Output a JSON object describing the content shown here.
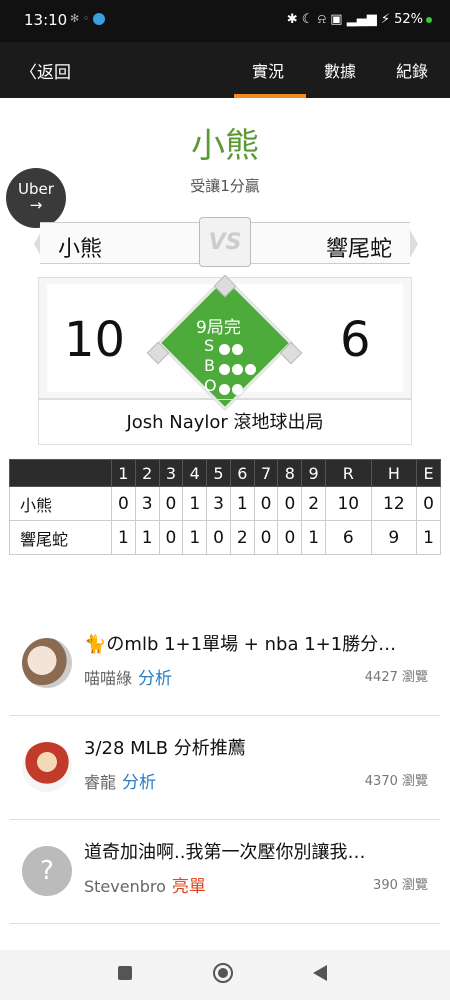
{
  "status_bar": {
    "time": "13:10",
    "battery": "52%"
  },
  "nav": {
    "back_label": "返回",
    "tabs": [
      {
        "label": "實況",
        "active": true
      },
      {
        "label": "數據",
        "active": false
      },
      {
        "label": "紀錄",
        "active": false
      }
    ]
  },
  "game": {
    "winner": "小熊",
    "result_text": "受讓1分贏",
    "team_home": "小熊",
    "team_away": "響尾蛇",
    "vs_label": "VS",
    "score_home": "10",
    "score_away": "6",
    "inning_status": "9局完",
    "count_labels": {
      "s": "S",
      "b": "B",
      "o": "O"
    },
    "count": {
      "strikes": 0,
      "balls": 0,
      "outs": 0
    },
    "last_play": "Josh Naylor 滾地球出局"
  },
  "ad": {
    "label": "Uber",
    "arrow": "→"
  },
  "boxscore": {
    "headers": [
      "1",
      "2",
      "3",
      "4",
      "5",
      "6",
      "7",
      "8",
      "9",
      "R",
      "H",
      "E"
    ],
    "rows": [
      {
        "team": "小熊",
        "values": [
          "0",
          "3",
          "0",
          "1",
          "3",
          "1",
          "0",
          "0",
          "2",
          "10",
          "12",
          "0"
        ]
      },
      {
        "team": "響尾蛇",
        "values": [
          "1",
          "1",
          "0",
          "1",
          "0",
          "2",
          "0",
          "0",
          "1",
          "6",
          "9",
          "1"
        ]
      }
    ]
  },
  "posts": [
    {
      "title": "🐈のmlb 1+1單場 + nba 1+1勝分…",
      "author": "喵喵綠",
      "tag": "分析",
      "tag_color": "#2a7ec4",
      "views": "4427 瀏覽"
    },
    {
      "title": "3/28 MLB 分析推薦",
      "author": "睿龍",
      "tag": "分析",
      "tag_color": "#2a7ec4",
      "views": "4370 瀏覽"
    },
    {
      "title": "道奇加油啊..我第一次壓你別讓我…",
      "author": "Stevenbro",
      "tag": "亮單",
      "tag_color": "#e0451c",
      "views": "390 瀏覽"
    }
  ],
  "colors": {
    "accent": "#f28a1c",
    "winner_green": "#5a9a32",
    "field_green": "#4cab3a"
  }
}
